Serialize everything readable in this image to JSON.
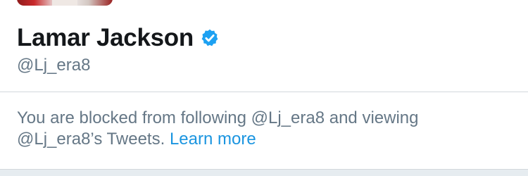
{
  "profile": {
    "display_name": "Lamar Jackson",
    "handle": "@Lj_era8",
    "verified": true,
    "avatar_icon": "profile-photo"
  },
  "blocked_notice": {
    "line1": "You are blocked from following @Lj_era8 and viewing",
    "line2": "@Lj_era8’s Tweets.",
    "link_label": "Learn more"
  },
  "colors": {
    "name": "#14171a",
    "secondary_text": "#657786",
    "link": "#1b95e0",
    "verified_badge": "#1da1f2",
    "divider": "#d3d8dc"
  }
}
